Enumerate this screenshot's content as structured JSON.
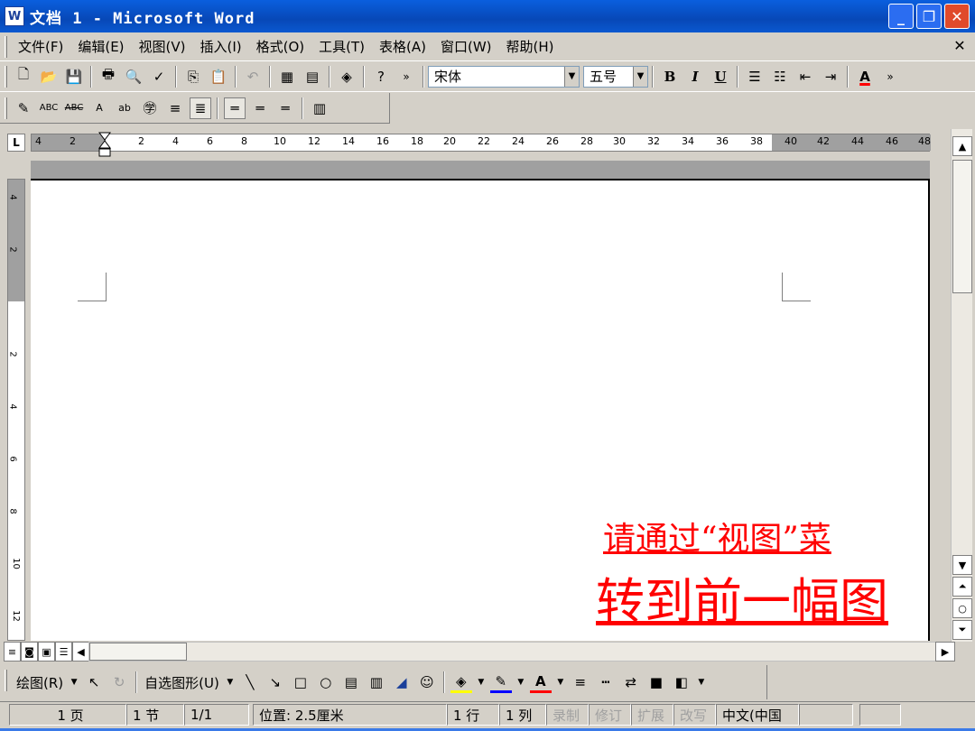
{
  "window": {
    "title": "文档 1 - Microsoft Word",
    "app_icon": "word-doc-icon",
    "buttons": {
      "minimize": "_",
      "restore": "❐",
      "close": "✕"
    }
  },
  "menu": {
    "items": [
      "文件(F)",
      "编辑(E)",
      "视图(V)",
      "插入(I)",
      "格式(O)",
      "工具(T)",
      "表格(A)",
      "窗口(W)",
      "帮助(H)"
    ],
    "close_glyph": "✕"
  },
  "standard_toolbar": {
    "font_name": "宋体",
    "font_size": "五号",
    "bold": "B",
    "italic": "I",
    "underline": "U",
    "font_color_glyph": "A"
  },
  "ruler": {
    "tab_selector": "L",
    "ticks": [
      "4",
      "2",
      "2",
      "4",
      "6",
      "8",
      "10",
      "12",
      "14",
      "16",
      "18",
      "20",
      "22",
      "24",
      "26",
      "28",
      "30",
      "32",
      "34",
      "36",
      "38",
      "40",
      "42",
      "44",
      "46",
      "48"
    ],
    "vticks": [
      "4",
      "2",
      "2",
      "4",
      "6",
      "8",
      "10",
      "12"
    ]
  },
  "document": {
    "caption_line1": "请通过“视图”菜",
    "caption_line2": "转到前一幅图"
  },
  "drawing_toolbar": {
    "draw_label": "绘图(R)",
    "autoshapes_label": "自选图形(U)"
  },
  "status": {
    "page": "1 页",
    "section": "1 节",
    "page_of": "1/1",
    "position": "位置: 2.5厘米",
    "line": "1 行",
    "column": "1 列",
    "rec": "录制",
    "trk": "修订",
    "ext": "扩展",
    "ovr": "改写",
    "language": "中文(中国"
  },
  "colors": {
    "title_bar": "#0a5fde",
    "caption_red": "#ff0000",
    "chrome": "#d4d0c8"
  }
}
